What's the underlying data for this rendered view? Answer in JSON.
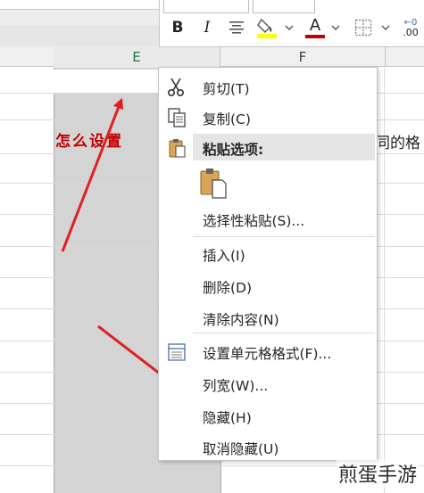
{
  "spreadsheet": {
    "column_e": "E",
    "column_f": "F",
    "annotation_text": "怎么设置",
    "cell_text": "同的格"
  },
  "toolbar": {
    "bold": "B",
    "italic": "I",
    "font_color": "A",
    "font_color_underline": "#c00000",
    "fill_color_underline": "#ffff00",
    "decimal_label": ".00"
  },
  "context_menu": {
    "cut": "剪切(T)",
    "copy": "复制(C)",
    "paste_options": "粘贴选项:",
    "paste_special": "选择性粘贴(S)...",
    "insert": "插入(I)",
    "delete": "删除(D)",
    "clear_contents": "清除内容(N)",
    "format_cells": "设置单元格格式(F)...",
    "column_width": "列宽(W)...",
    "hide": "隐藏(H)",
    "unhide": "取消隐藏(U)"
  },
  "watermark": "煎蛋手游",
  "colors": {
    "accent_green": "#217346",
    "arrow_red": "#e02020"
  }
}
